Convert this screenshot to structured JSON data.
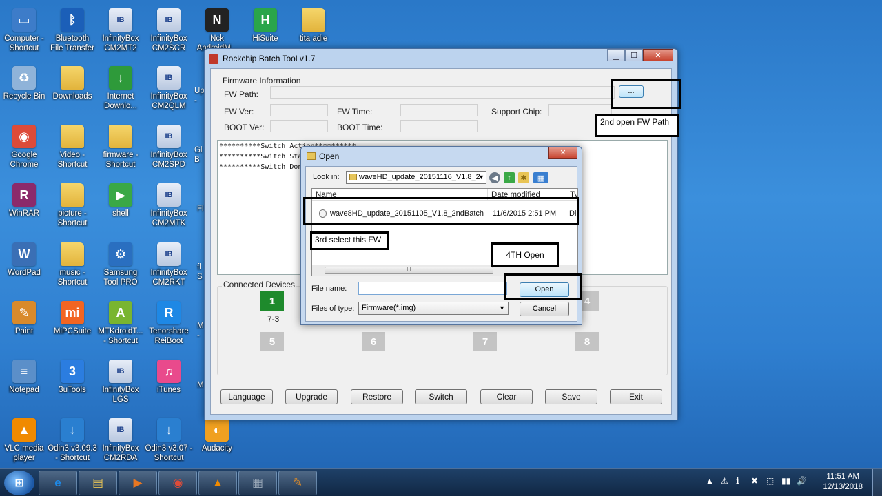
{
  "desktop": {
    "icons": [
      {
        "label": "Computer -\nShortcut",
        "icon": "computer-icon",
        "glyph": "▭",
        "color": "#3d7cc9"
      },
      {
        "label": "Bluetooth\nFile Transfer",
        "icon": "bluetooth-icon",
        "glyph": "ᛒ",
        "color": "#1b5fb8"
      },
      {
        "label": "InfinityBox\nCM2MT2",
        "icon": "infinitybox-icon",
        "glyph": "IB",
        "color": "#c0d0ea"
      },
      {
        "label": "InfinityBox\nCM2SCR",
        "icon": "infinitybox-icon",
        "glyph": "IB",
        "color": "#c0d0ea"
      },
      {
        "label": "Nck\nAndroidM...",
        "icon": "nck-icon",
        "glyph": "N",
        "color": "#222222"
      },
      {
        "label": "HiSuite",
        "icon": "hisuite-icon",
        "glyph": "H",
        "color": "#2aa54a"
      },
      {
        "label": "tita adie",
        "icon": "folder-icon",
        "glyph": "",
        "color": "#e8c455"
      },
      {
        "label": "Recycle Bin",
        "icon": "recycle-bin-icon",
        "glyph": "♻",
        "color": "#8fb3d9"
      },
      {
        "label": "Downloads",
        "icon": "folder-icon",
        "glyph": "",
        "color": "#e8c455"
      },
      {
        "label": "Internet\nDownlo...",
        "icon": "idm-icon",
        "glyph": "↓",
        "color": "#2e9a3a"
      },
      {
        "label": "InfinityBox\nCM2QLM",
        "icon": "infinitybox-icon",
        "glyph": "IB",
        "color": "#c0d0ea"
      },
      {
        "label": "Google\nChrome",
        "icon": "chrome-icon",
        "glyph": "◉",
        "color": "#dd4b39"
      },
      {
        "label": "Video -\nShortcut",
        "icon": "folder-icon",
        "glyph": "",
        "color": "#e8c455"
      },
      {
        "label": "firmware -\nShortcut",
        "icon": "folder-icon",
        "glyph": "",
        "color": "#e8c455"
      },
      {
        "label": "InfinityBox\nCM2SPD",
        "icon": "infinitybox-icon",
        "glyph": "IB",
        "color": "#c0d0ea"
      },
      {
        "label": "WinRAR",
        "icon": "winrar-icon",
        "glyph": "R",
        "color": "#8b2a6b"
      },
      {
        "label": "picture -\nShortcut",
        "icon": "folder-icon",
        "glyph": "",
        "color": "#e8c455"
      },
      {
        "label": "shell",
        "icon": "shell-icon",
        "glyph": "▶",
        "color": "#3aa846"
      },
      {
        "label": "InfinityBox\nCM2MTK",
        "icon": "infinitybox-icon",
        "glyph": "IB",
        "color": "#c0d0ea"
      },
      {
        "label": "WordPad",
        "icon": "wordpad-icon",
        "glyph": "W",
        "color": "#3a6fb5"
      },
      {
        "label": "music -\nShortcut",
        "icon": "folder-icon",
        "glyph": "",
        "color": "#e8c455"
      },
      {
        "label": "Samsung\nTool PRO",
        "icon": "samsung-tool-icon",
        "glyph": "⚙",
        "color": "#2a6fc0"
      },
      {
        "label": "InfinityBox\nCM2RKT",
        "icon": "infinitybox-icon",
        "glyph": "IB",
        "color": "#c0d0ea"
      },
      {
        "label": "Paint",
        "icon": "paint-icon",
        "glyph": "✎",
        "color": "#d98a2b"
      },
      {
        "label": "MiPCSuite",
        "icon": "mipcsuite-icon",
        "glyph": "mi",
        "color": "#f26522"
      },
      {
        "label": "MTKdroidT...\n- Shortcut",
        "icon": "mtkdroid-icon",
        "glyph": "A",
        "color": "#79b530"
      },
      {
        "label": "Tenorshare\nReiBoot",
        "icon": "reiboot-icon",
        "glyph": "R",
        "color": "#1e88e5"
      },
      {
        "label": "Notepad",
        "icon": "notepad-icon",
        "glyph": "≡",
        "color": "#5b8fc9"
      },
      {
        "label": "3uTools",
        "icon": "3utools-icon",
        "glyph": "3",
        "color": "#2b7de0"
      },
      {
        "label": "InfinityBox\nLGS",
        "icon": "infinitybox-icon",
        "glyph": "IB",
        "color": "#c0d0ea"
      },
      {
        "label": "iTunes",
        "icon": "itunes-icon",
        "glyph": "♫",
        "color": "#e94a8c"
      },
      {
        "label": "VLC media\nplayer",
        "icon": "vlc-icon",
        "glyph": "▲",
        "color": "#f08a00"
      },
      {
        "label": "Odin3 v3.09.3\n- Shortcut",
        "icon": "odin-icon",
        "glyph": "↓",
        "color": "#2a7fd0"
      },
      {
        "label": "InfinityBox\nCM2RDA",
        "icon": "infinitybox-icon",
        "glyph": "IB",
        "color": "#c0d0ea"
      },
      {
        "label": "Odin3 v3.07 -\nShortcut",
        "icon": "odin-icon",
        "glyph": "↓",
        "color": "#2a7fd0"
      },
      {
        "label": "Audacity",
        "icon": "audacity-icon",
        "glyph": "◐",
        "color": "#f0a020"
      }
    ],
    "partial_labels": [
      "Up\n-",
      "Gl\nB",
      "Fl",
      "fl\nS",
      "M\n-",
      "M"
    ]
  },
  "main_window": {
    "title": "Rockchip Batch Tool v1.7",
    "caption": {
      "minimize": "▁",
      "maximize": "☐",
      "close": "✕"
    },
    "firmware_group": "Firmware Information",
    "fw_path_label": "FW Path:",
    "browse_label": "...",
    "fw_ver_label": "FW Ver:",
    "fw_time_label": "FW Time:",
    "support_chip_label": "Support Chip:",
    "boot_ver_label": "BOOT Ver:",
    "boot_time_label": "BOOT Time:",
    "log_lines": [
      "**********Switch Action**********",
      "**********Switch Star",
      "**********Switch Done"
    ],
    "connected_devices_label": "Connected Devices",
    "devices": [
      {
        "number": "1",
        "active": true,
        "port": "7-3"
      },
      {
        "number": "4",
        "active": false,
        "port": ""
      },
      {
        "number": "5",
        "active": false,
        "port": ""
      },
      {
        "number": "6",
        "active": false,
        "port": ""
      },
      {
        "number": "7",
        "active": false,
        "port": ""
      },
      {
        "number": "8",
        "active": false,
        "port": ""
      }
    ],
    "buttons": [
      "Language",
      "Upgrade",
      "Restore",
      "Switch",
      "Clear",
      "Save",
      "Exit"
    ]
  },
  "annotations": {
    "second": "2nd open FW Path",
    "third": "3rd select this FW",
    "fourth": "4TH Open"
  },
  "open_dialog": {
    "title": "Open",
    "close": "✕",
    "look_in_label": "Look in:",
    "look_in_value": "waveHD_update_20151116_V1.8_2",
    "columns": {
      "name": "Name",
      "date": "Date modified",
      "type": "Ty"
    },
    "file": {
      "name": "wave8HD_update_20151105_V1.8_2ndBatch",
      "date": "11/6/2015 2:51 PM",
      "type": "Di"
    },
    "scroll_grip": "III",
    "file_name_label": "File name:",
    "file_name_value": "",
    "files_of_type_label": "Files of type:",
    "files_of_type_value": "Firmware(*.img)",
    "open_button": "Open",
    "cancel_button": "Cancel"
  },
  "taskbar": {
    "start": "⊞",
    "apps": [
      {
        "name": "internet-explorer",
        "glyph": "e",
        "color": "#1e88e5"
      },
      {
        "name": "file-explorer",
        "glyph": "▤",
        "color": "#e8c455"
      },
      {
        "name": "media-player",
        "glyph": "▶",
        "color": "#e87722"
      },
      {
        "name": "chrome",
        "glyph": "◉",
        "color": "#dd4b39"
      },
      {
        "name": "vlc",
        "glyph": "▲",
        "color": "#f08a00"
      },
      {
        "name": "rockchip-batch-tool",
        "glyph": "▦",
        "color": "#9aa8b8"
      },
      {
        "name": "paint",
        "glyph": "✎",
        "color": "#d98a2b"
      }
    ],
    "tray_icons": [
      "▲",
      "⚠",
      "ℹ",
      "✖",
      "⬚",
      "▮▮",
      "🔊"
    ],
    "time": "11:51 AM",
    "date": "12/13/2018"
  },
  "colors": {
    "desktop": "#2f7fd0",
    "device_active": "#1e8a2c",
    "device_inactive": "#c4c4c4"
  }
}
